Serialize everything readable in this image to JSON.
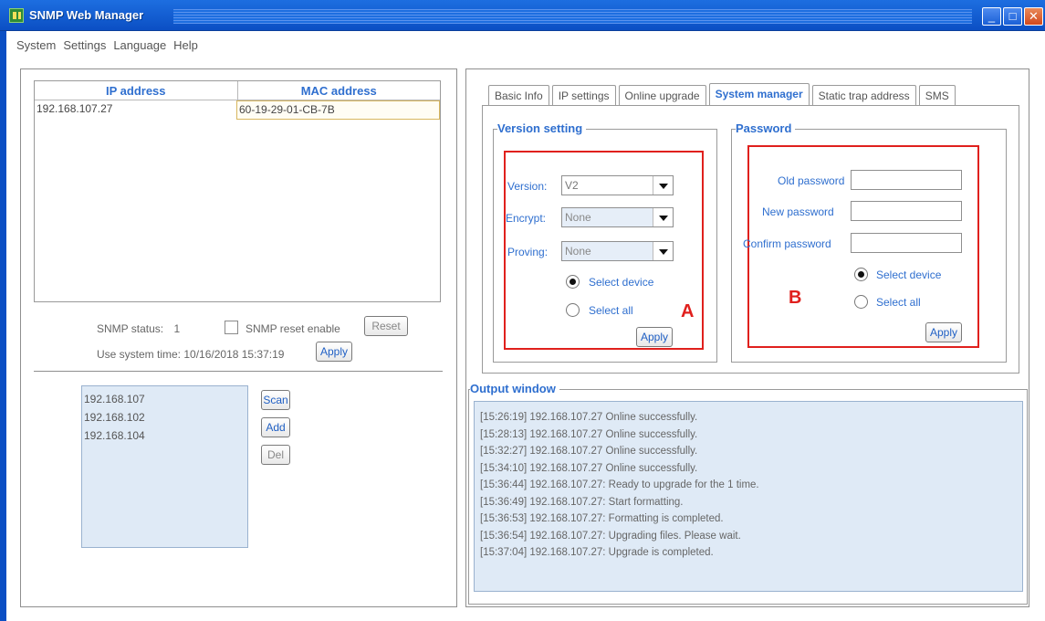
{
  "window": {
    "title": "SNMP Web Manager",
    "minimize": "_",
    "maximize": "□",
    "close": "✕"
  },
  "menu": [
    "System",
    "Settings",
    "Language",
    "Help"
  ],
  "device_table": {
    "headers": [
      "IP address",
      "MAC address"
    ],
    "rows": [
      {
        "ip": "192.168.107.27",
        "mac": "60-19-29-01-CB-7B"
      }
    ]
  },
  "status": {
    "snmp_status_label": "SNMP status:",
    "snmp_status_value": "1",
    "reset_enable_label": "SNMP reset enable",
    "reset_button": "Reset",
    "system_time_label": "Use system time:",
    "system_time_value": "10/16/2018 15:37:19",
    "apply_button": "Apply"
  },
  "subnets": [
    "192.168.107",
    "192.168.102",
    "192.168.104"
  ],
  "subnet_buttons": {
    "scan": "Scan",
    "add": "Add",
    "del": "Del"
  },
  "tabs": [
    {
      "label": "Basic Info",
      "active": false
    },
    {
      "label": "IP settings",
      "active": false
    },
    {
      "label": "Online upgrade",
      "active": false
    },
    {
      "label": "System manager",
      "active": true
    },
    {
      "label": "Static trap address",
      "active": false
    },
    {
      "label": "SMS",
      "active": false
    }
  ],
  "version_setting": {
    "title": "Version setting",
    "version_label": "Version:",
    "version_value": "V2",
    "encrypt_label": "Encrypt:",
    "encrypt_value": "None",
    "proving_label": "Proving:",
    "proving_value": "None",
    "select_device": "Select device",
    "select_all": "Select all",
    "apply": "Apply",
    "marker": "A"
  },
  "password": {
    "title": "Password",
    "old_label": "Old password",
    "new_label": "New password",
    "confirm_label": "Confirm password",
    "select_device": "Select device",
    "select_all": "Select all",
    "apply": "Apply",
    "marker": "B"
  },
  "output": {
    "title": "Output window",
    "lines": [
      "[15:26:19]   192.168.107.27 Online successfully.",
      "[15:28:13]   192.168.107.27 Online successfully.",
      "[15:32:27]   192.168.107.27 Online successfully.",
      "[15:34:10]   192.168.107.27 Online successfully.",
      "[15:36:44]   192.168.107.27: Ready to upgrade for the 1 time.",
      "[15:36:49]   192.168.107.27: Start formatting.",
      "[15:36:53]   192.168.107.27: Formatting is completed.",
      "[15:36:54]   192.168.107.27: Upgrading files. Please wait.",
      "[15:37:04]   192.168.107.27: Upgrade is completed."
    ]
  }
}
